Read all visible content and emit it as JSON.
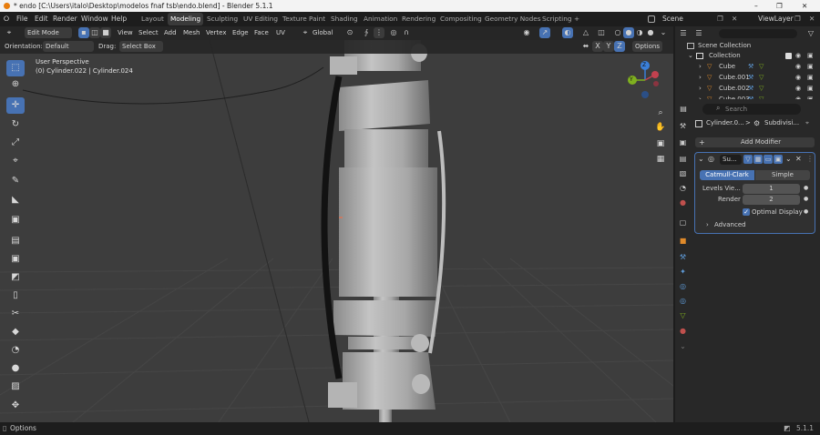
{
  "window": {
    "title": "* endo [C:\\Users\\italo\\Desktop\\modelos fnaf tsb\\endo.blend] - Blender 5.1.1",
    "minimize": "–",
    "maximize": "❐",
    "close": "✕"
  },
  "menu": [
    "File",
    "Edit",
    "Render",
    "Window",
    "Help"
  ],
  "workspaces": [
    "Layout",
    "Modeling",
    "Sculpting",
    "UV Editing",
    "Texture Paint",
    "Shading",
    "Animation",
    "Rendering",
    "Compositing",
    "Geometry Nodes",
    "Scripting"
  ],
  "workspace_add": "+",
  "scene": {
    "label": "Scene",
    "view_layer": "ViewLayer"
  },
  "header": {
    "mode": "Edit Mode",
    "view": "View",
    "select": "Select",
    "add": "Add",
    "mesh": "Mesh",
    "vertex": "Vertex",
    "edge": "Edge",
    "face": "Face",
    "uv": "UV",
    "transform": "Global",
    "axes": [
      "X",
      "Y",
      "Z"
    ],
    "options": "Options"
  },
  "tool_options": {
    "orientation_label": "Orientation:",
    "orientation": "Default",
    "drag_label": "Drag:",
    "drag": "Select Box"
  },
  "viewport": {
    "perspective": "User Perspective",
    "object_info": "(0) Cylinder.022 | Cylinder.024",
    "gizmo": {
      "x": "X",
      "y": "Y",
      "z": "Z"
    }
  },
  "outliner": {
    "search_placeholder": "",
    "title": "Scene Collection",
    "collection": "Collection",
    "items": [
      {
        "name": "Cube"
      },
      {
        "name": "Cube.001"
      },
      {
        "name": "Cube.002"
      },
      {
        "name": "Cube.003"
      }
    ]
  },
  "properties": {
    "search_placeholder": "Search",
    "breadcrumb_object": "Cylinder.0...",
    "breadcrumb_sep": ">",
    "breadcrumb_modifier": "Subdivisi...",
    "add_modifier": "Add Modifier",
    "modifier": {
      "name": "Su...",
      "mode_catmull": "Catmull-Clark",
      "mode_simple": "Simple",
      "levels_label": "Levels Vie...",
      "levels_value": "1",
      "render_label": "Render",
      "render_value": "2",
      "optimal_label": "Optimal Display",
      "advanced_label": "Advanced"
    }
  },
  "status": {
    "left": "Options",
    "version": "5.1.1"
  },
  "colors": {
    "accent": "#4772b3",
    "viewport_bg": "#3d3d3d",
    "panel_bg": "#282828",
    "header_bg": "#262626",
    "mesh": "#a3a3a3"
  },
  "icons": [
    "blender-logo-icon",
    "cursor-icon",
    "move-icon",
    "rotate-icon",
    "scale-icon",
    "transform-icon",
    "annotate-icon",
    "measure-icon",
    "extrude-icon",
    "inset-icon",
    "bevel-icon",
    "loop-cut-icon",
    "knife-icon",
    "poly-build-icon",
    "spin-icon",
    "smooth-icon",
    "edge-slide-icon",
    "shrink-icon",
    "shear-icon",
    "zoom-icon",
    "hand-icon",
    "camera-icon",
    "grid-icon",
    "wrench-icon",
    "eye-icon",
    "camera-render-icon",
    "triangle-mesh-icon",
    "filter-icon"
  ]
}
